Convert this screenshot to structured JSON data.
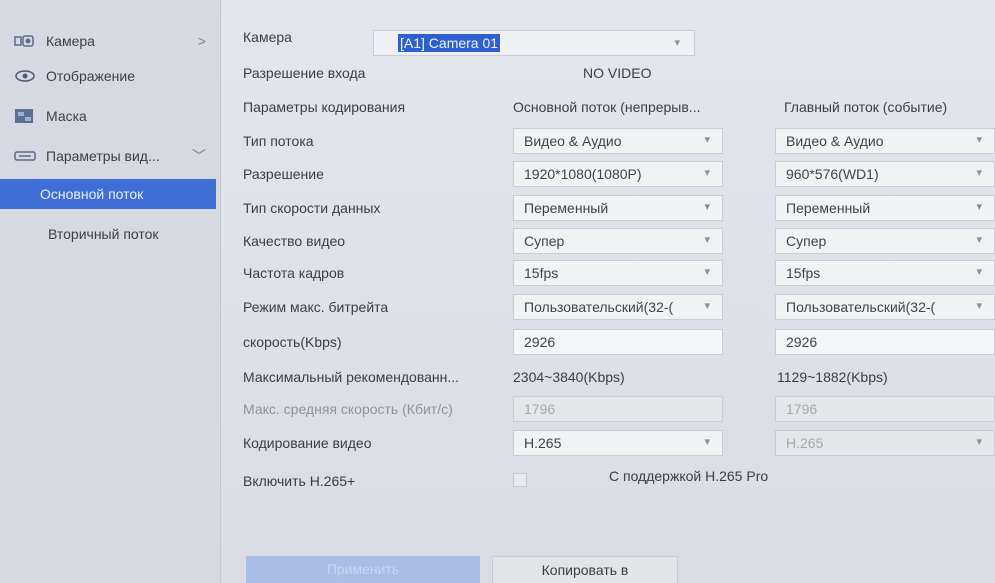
{
  "sidebar": {
    "items": [
      {
        "label": "Камера",
        "icon": "camera-icon",
        "arrow": ">"
      },
      {
        "label": "Отображение",
        "icon": "eye-icon"
      },
      {
        "label": "Маска",
        "icon": "mask-icon"
      },
      {
        "label": "Параметры вид...",
        "icon": "video-params-icon",
        "arrow": "﹀"
      }
    ],
    "sub_items": [
      {
        "label": "Основной поток",
        "active": true
      },
      {
        "label": "Вторичный поток",
        "active": false
      }
    ]
  },
  "main": {
    "camera": {
      "label": "Камера",
      "value": "[A1] Camera 01"
    },
    "input_resolution": {
      "label": "Разрешение входа",
      "value": "NO VIDEO"
    },
    "encoding_params": {
      "label": "Параметры кодирования",
      "col1": "Основной поток (непрерыв...",
      "col2": "Главный поток (событие)"
    },
    "rows": [
      {
        "label": "Тип потока",
        "col1": "Видео & Аудио",
        "col2": "Видео & Аудио"
      },
      {
        "label": "Разрешение",
        "col1": "1920*1080(1080P)",
        "col2": "960*576(WD1)"
      },
      {
        "label": "Тип скорости данных",
        "col1": "Переменный",
        "col2": "Переменный"
      },
      {
        "label": "Качество видео",
        "col1": "Супер",
        "col2": "Супер"
      },
      {
        "label": "Частота кадров",
        "col1": "15fps",
        "col2": "15fps"
      },
      {
        "label": "Режим макс. битрейта",
        "col1": "Пользовательский(32-(",
        "col2": "Пользовательский(32-("
      }
    ],
    "bitrate": {
      "label": "скорость(Kbps)",
      "col1": "2926",
      "col2": "2926"
    },
    "max_recommended": {
      "label": "Максимальный рекомендованн...",
      "col1": "2304~3840(Kbps)",
      "col2": "1129~1882(Kbps)"
    },
    "avg_speed": {
      "label": "Макс. средняя скорость (Кбит/с)",
      "col1": "1796",
      "col2": "1796"
    },
    "video_encoding": {
      "label": "Кодирование видео",
      "col1": "H.265",
      "col2": "H.265"
    },
    "h265plus": {
      "label": "Включить H.265+",
      "note": "С поддержкой H.265 Pro"
    },
    "buttons": {
      "apply": "Применить",
      "copy": "Копировать в"
    }
  },
  "colors": {
    "accent": "#3f6fd6",
    "highlight": "#2f5fd0",
    "background": "#dcdfe6"
  }
}
